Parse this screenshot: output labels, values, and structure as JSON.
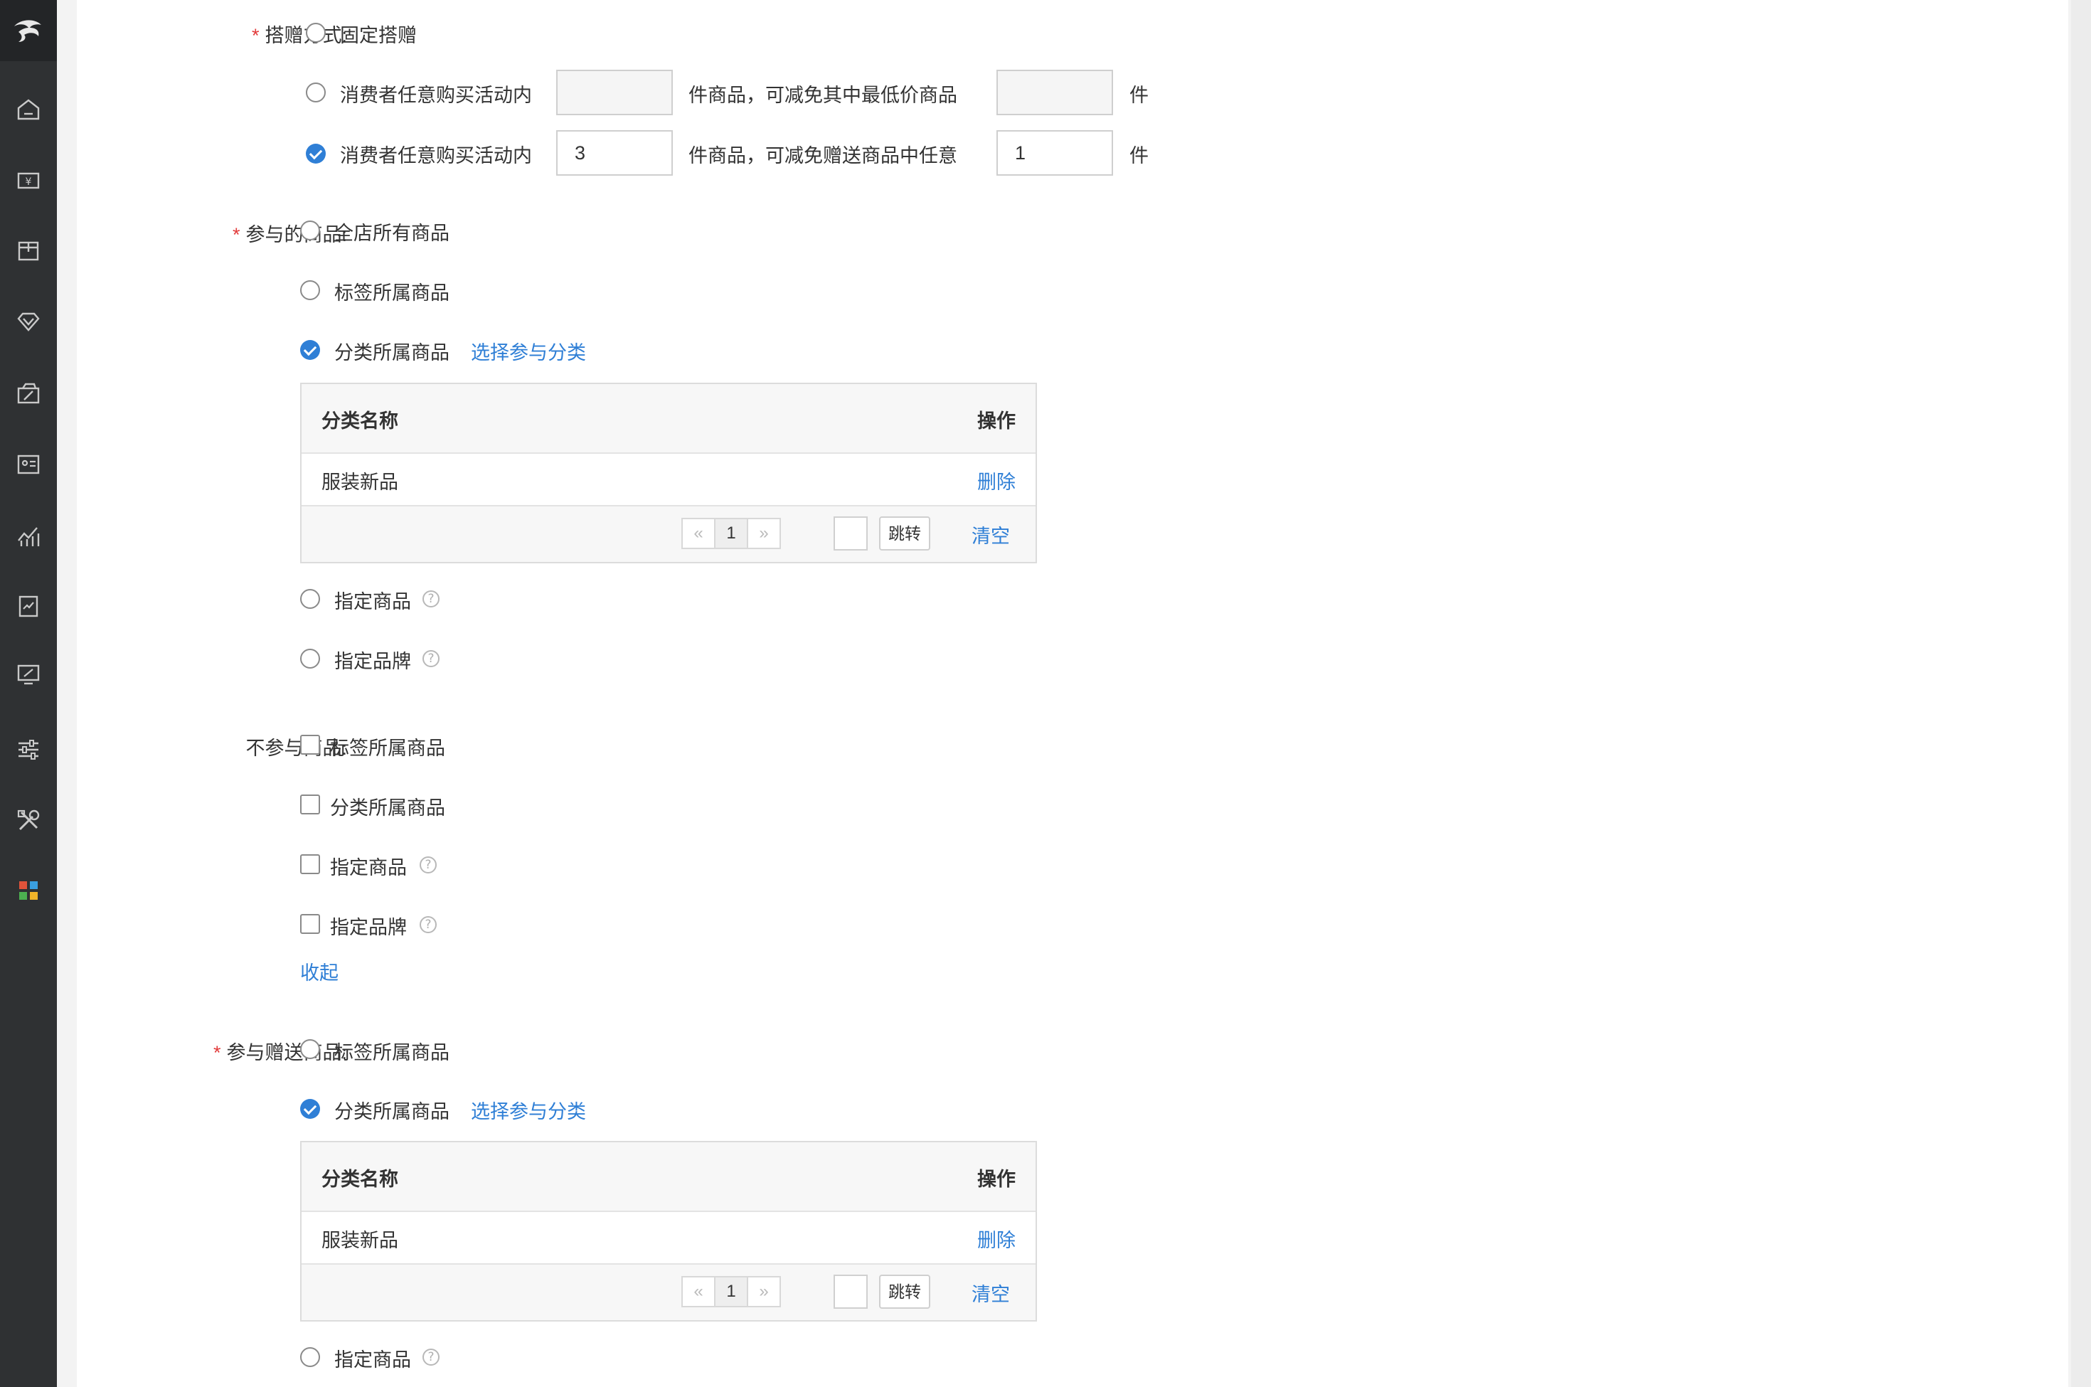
{
  "form": {
    "gift_method": {
      "required": "*",
      "label": "搭赠方式:",
      "options": [
        {
          "label": "固定搭赠",
          "checked": false
        },
        {
          "prefix": "消费者任意购买活动内",
          "value1": "",
          "middle": "件商品，可减免其中最低价商品",
          "value2": "",
          "suffix": "件",
          "checked": false
        },
        {
          "prefix": "消费者任意购买活动内",
          "value1": "3",
          "middle": "件商品，可减免赠送商品中任意",
          "value2": "1",
          "suffix": "件",
          "checked": true
        }
      ]
    },
    "participating_goods": {
      "required": "*",
      "label": "参与的商品:",
      "options": [
        {
          "label": "全店所有商品",
          "checked": false
        },
        {
          "label": "标签所属商品",
          "checked": false
        },
        {
          "label": "分类所属商品",
          "checked": true,
          "link": "选择参与分类"
        },
        {
          "label": "指定商品",
          "checked": false,
          "help": "?"
        },
        {
          "label": "指定品牌",
          "checked": false,
          "help": "?"
        }
      ],
      "table": {
        "col_name": "分类名称",
        "col_action": "操作",
        "rows": [
          {
            "name": "服装新品",
            "action": "删除"
          }
        ],
        "pager": {
          "prev": "«",
          "page": "1",
          "next": "»",
          "jump": "跳转",
          "clear": "清空"
        }
      }
    },
    "excluded_goods": {
      "label": "不参与商品:",
      "options": [
        {
          "label": "标签所属商品",
          "checked": false
        },
        {
          "label": "分类所属商品",
          "checked": false
        },
        {
          "label": "指定商品",
          "checked": false,
          "help": "?"
        },
        {
          "label": "指定品牌",
          "checked": false,
          "help": "?"
        }
      ],
      "collapse": "收起"
    },
    "gift_goods": {
      "required": "*",
      "label": "参与赠送商品:",
      "options": [
        {
          "label": "标签所属商品",
          "checked": false
        },
        {
          "label": "分类所属商品",
          "checked": true,
          "link": "选择参与分类"
        },
        {
          "label": "指定商品",
          "checked": false,
          "help": "?"
        }
      ],
      "table": {
        "col_name": "分类名称",
        "col_action": "操作",
        "rows": [
          {
            "name": "服装新品",
            "action": "删除"
          }
        ],
        "pager": {
          "prev": "«",
          "page": "1",
          "next": "»",
          "jump": "跳转",
          "clear": "清空"
        }
      }
    }
  },
  "sidebar": {
    "icons": [
      "logo-icon",
      "home-icon",
      "money-icon",
      "box-icon",
      "diamond-icon",
      "coupon-icon",
      "contact-card-icon",
      "chart-icon",
      "report-icon",
      "monitor-icon",
      "sliders-icon",
      "tools-icon",
      "apps-icon"
    ]
  },
  "colors": {
    "accent": "#2f7fd6",
    "required": "#e23b3b",
    "sidebar": "#2f3133"
  }
}
